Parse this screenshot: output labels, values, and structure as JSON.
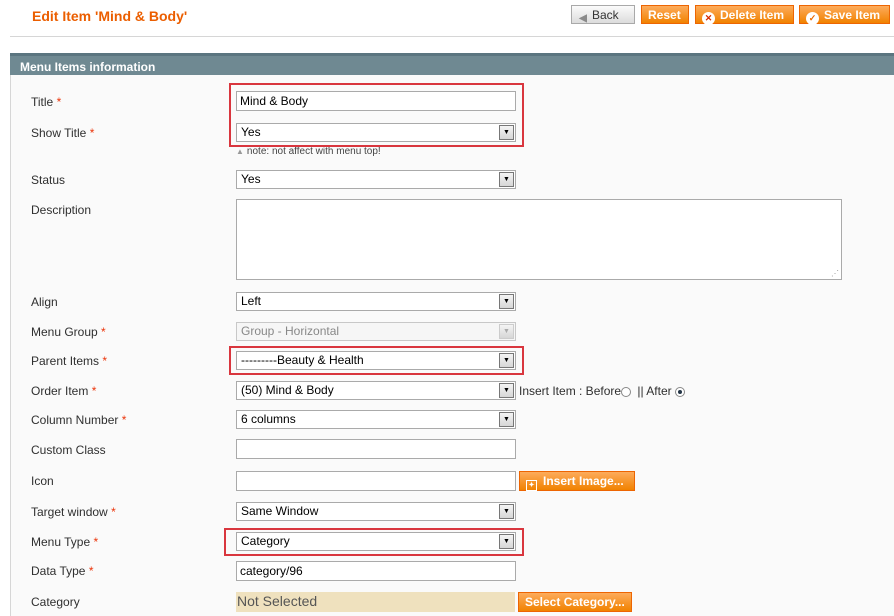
{
  "header": {
    "title": "Edit Item 'Mind & Body'",
    "back_label": "Back",
    "reset_label": "Reset",
    "delete_label": "Delete Item",
    "save_label": "Save Item"
  },
  "section": {
    "title": "Menu Items information"
  },
  "fields": {
    "title": {
      "label": "Title",
      "value": "Mind & Body"
    },
    "show_title": {
      "label": "Show Title",
      "value": "Yes",
      "note": "note: not affect with menu top!"
    },
    "status": {
      "label": "Status",
      "value": "Yes"
    },
    "description": {
      "label": "Description",
      "value": ""
    },
    "align": {
      "label": "Align",
      "value": "Left"
    },
    "menu_group": {
      "label": "Menu Group",
      "value": "Group - Horizontal"
    },
    "parent_items": {
      "label": "Parent Items",
      "value": "---------Beauty & Health"
    },
    "order_item": {
      "label": "Order Item",
      "value": "(50) Mind & Body",
      "insert_label": "Insert Item : Before",
      "after_label": "|| After"
    },
    "column_number": {
      "label": "Column Number",
      "value": "6 columns"
    },
    "custom_class": {
      "label": "Custom Class",
      "value": ""
    },
    "icon": {
      "label": "Icon",
      "value": "",
      "button_label": "Insert Image..."
    },
    "target_window": {
      "label": "Target window",
      "value": "Same Window"
    },
    "menu_type": {
      "label": "Menu Type",
      "value": "Category"
    },
    "data_type": {
      "label": "Data Type",
      "value": "category/96"
    },
    "category": {
      "label": "Category",
      "value": "Not Selected",
      "button_label": "Select Category..."
    }
  },
  "required_mark": "*",
  "icons": {
    "back": "back-arrow-icon",
    "reset": "none",
    "delete": "delete-x-icon",
    "save": "checkmark-icon",
    "insert_image": "image-icon",
    "select_arrow": "chevron-down-icon"
  },
  "colors": {
    "title": "#eb5e00",
    "button_orange": "#f18200",
    "section_header": "#6f8992",
    "required": "#eb340a",
    "highlight_box": "#d9363e",
    "not_selected_bg": "#efe1be"
  }
}
